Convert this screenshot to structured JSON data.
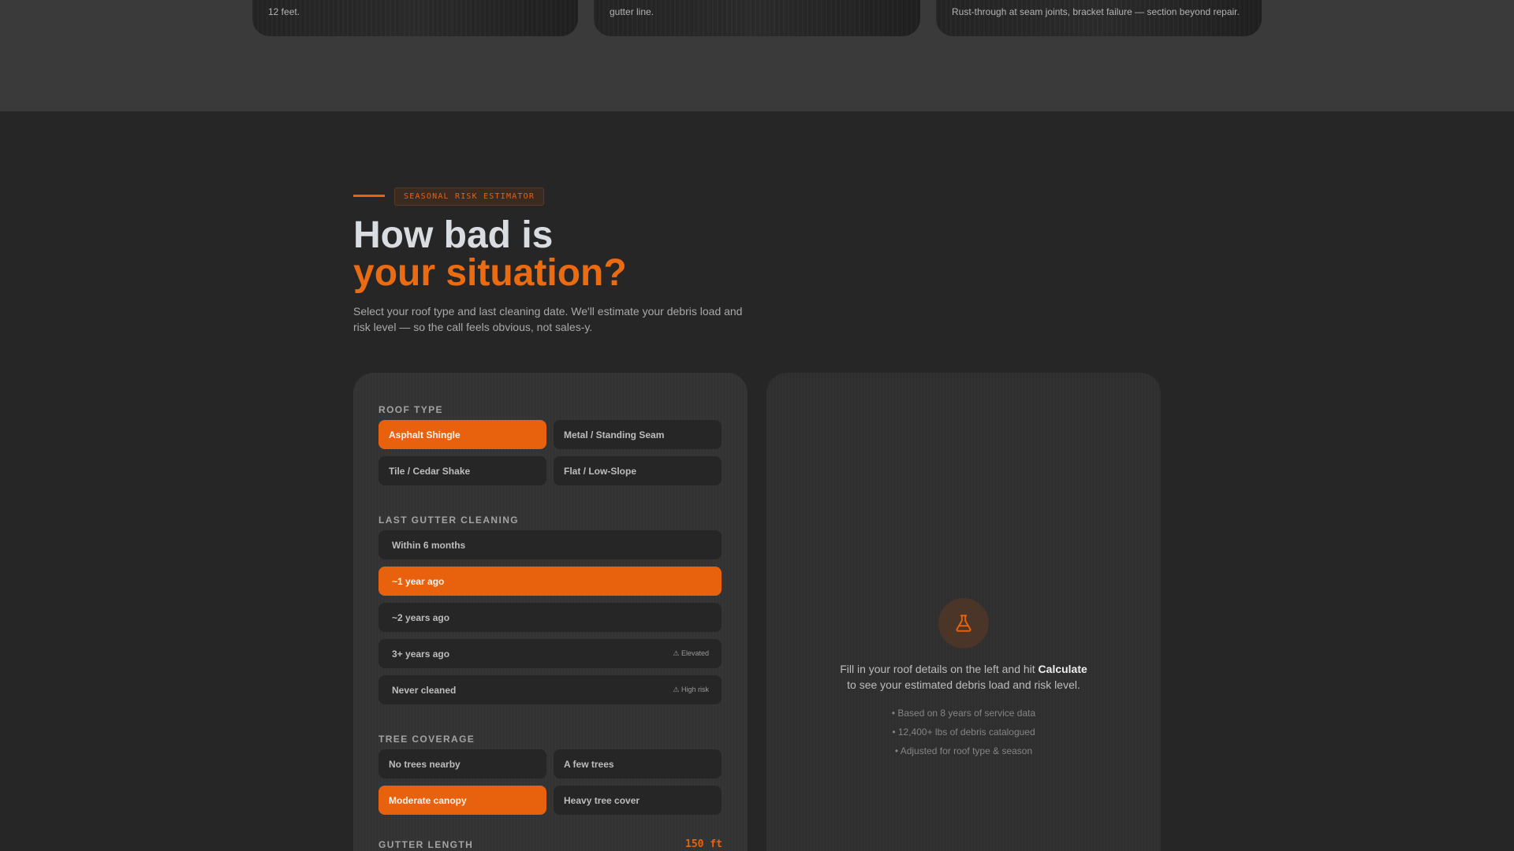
{
  "top_cards": [
    {
      "caption": "12 feet."
    },
    {
      "caption": "gutter line."
    },
    {
      "caption": "Rust-through at seam joints, bracket failure — section beyond repair."
    }
  ],
  "section": {
    "eyebrow": "SEASONAL RISK ESTIMATOR",
    "headline_line1": "How bad is",
    "headline_line2": "your situation?",
    "subtext": "Select your roof type and last cleaning date. We'll estimate your debris load and risk level — so the call feels obvious, not sales-y."
  },
  "form": {
    "roof_type": {
      "label": "ROOF TYPE",
      "options": [
        "Asphalt Shingle",
        "Metal / Standing Seam",
        "Tile / Cedar Shake",
        "Flat / Low-Slope"
      ],
      "selected": "Asphalt Shingle"
    },
    "last_cleaning": {
      "label": "LAST GUTTER CLEANING",
      "options": [
        {
          "label": "Within 6 months",
          "tag": ""
        },
        {
          "label": "~1 year ago",
          "tag": ""
        },
        {
          "label": "~2 years ago",
          "tag": ""
        },
        {
          "label": "3+ years ago",
          "tag": "⚠ Elevated"
        },
        {
          "label": "Never cleaned",
          "tag": "⚠ High risk"
        }
      ],
      "selected": "~1 year ago"
    },
    "tree_coverage": {
      "label": "TREE COVERAGE",
      "options": [
        "No trees nearby",
        "A few trees",
        "Moderate canopy",
        "Heavy tree cover"
      ],
      "selected": "Moderate canopy"
    },
    "gutter_length": {
      "label": "GUTTER LENGTH",
      "value": "150 ft"
    }
  },
  "result": {
    "icon": "flask-icon",
    "prompt_before": "Fill in your roof details on the left and hit ",
    "prompt_bold": "Calculate",
    "prompt_after": " to see your estimated debris load and risk level.",
    "bullets": [
      "• Based on 8 years of service data",
      "• 12,400+ lbs of debris catalogued",
      "• Adjusted for roof type & season"
    ]
  },
  "colors": {
    "accent": "#e8620e",
    "background": "#262626",
    "panel": "#333333"
  }
}
